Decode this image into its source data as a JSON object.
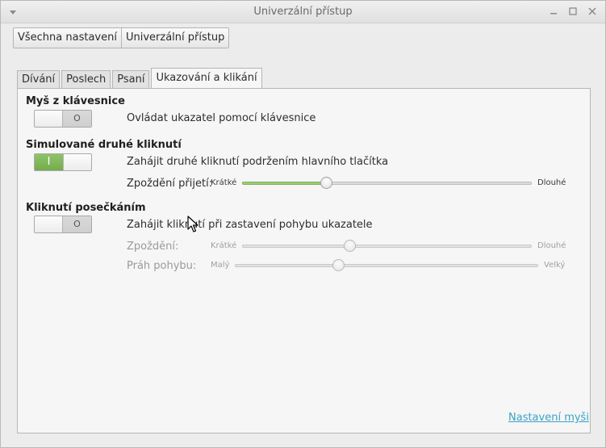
{
  "window": {
    "title": "Univerzální přístup",
    "icons": [
      "window-menu-arrow-icon",
      "minimize-icon",
      "maximize-icon",
      "close-icon"
    ]
  },
  "breadcrumb": {
    "all_settings": "Všechna nastavení",
    "current": "Univerzální přístup"
  },
  "tabs": [
    {
      "label": "Dívání",
      "active": false
    },
    {
      "label": "Poslech",
      "active": false
    },
    {
      "label": "Psaní",
      "active": false
    },
    {
      "label": "Ukazování a klikání",
      "active": true
    }
  ],
  "mouse_keys": {
    "heading": "Myš z klávesnice",
    "switch_state": "off",
    "switch_glyph": "O",
    "description": "Ovládat ukazatel pomocí klávesnice"
  },
  "simulated_secondary_click": {
    "heading": "Simulované druhé kliknutí",
    "switch_state": "on",
    "switch_glyph": "I",
    "description": "Zahájit druhé kliknutí podržením hlavního tlačítka",
    "delay_label": "Zpoždění přijetí:",
    "delay_min": "Krátké",
    "delay_max": "Dlouhé",
    "delay_value": 0.29
  },
  "dwell_click": {
    "heading": "Kliknutí posečkáním",
    "switch_state": "off",
    "switch_glyph": "O",
    "description": "Zahájit kliknutí při zastavení pohybu ukazatele",
    "delay_label": "Zpoždění:",
    "delay_min": "Krátké",
    "delay_max": "Dlouhé",
    "delay_value": 0.37,
    "threshold_label": "Práh pohybu:",
    "threshold_min": "Malý",
    "threshold_max": "Velký",
    "threshold_value": 0.34
  },
  "footer": {
    "mouse_settings_link": "Nastavení myši"
  },
  "colors": {
    "switch_on": "#7db356",
    "slider_fill": "#9ccb74",
    "link": "#3aa2c4"
  }
}
